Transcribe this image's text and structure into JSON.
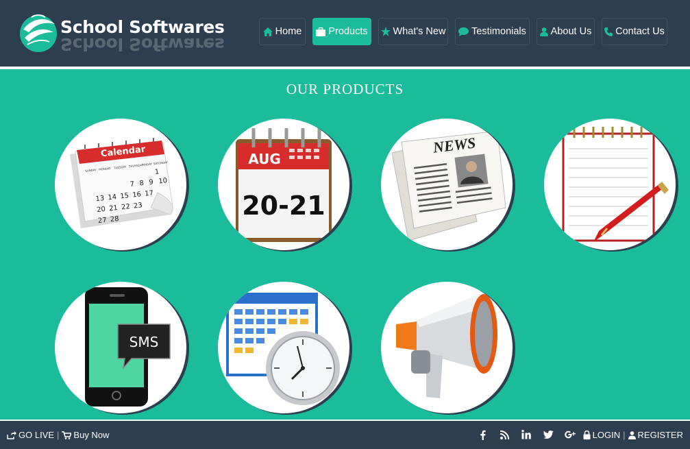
{
  "brand": {
    "title": "School Softwares"
  },
  "nav": {
    "items": [
      {
        "label": "Home",
        "icon": "home-icon"
      },
      {
        "label": "Products",
        "icon": "briefcase-icon",
        "active": true
      },
      {
        "label": "What's New",
        "icon": "star-icon"
      },
      {
        "label": "Testimonials",
        "icon": "comment-icon"
      },
      {
        "label": "About Us",
        "icon": "user-icon"
      },
      {
        "label": "Contact Us",
        "icon": "phone-icon"
      }
    ]
  },
  "main": {
    "section_title": "OUR PRODUCTS",
    "products": [
      {
        "icon": "calendar-icon",
        "image_text": [
          "Calendar",
          "SUNDAY",
          "MONDAY",
          "TUESDAY",
          "THURSDAY",
          "FRIDAY",
          "SATURDAY",
          "1",
          "7",
          "8",
          "9",
          "10",
          "13",
          "14",
          "15",
          "16",
          "17",
          "20",
          "21",
          "22",
          "23",
          "27",
          "28"
        ]
      },
      {
        "icon": "date-calendar-icon",
        "image_text": [
          "AUG",
          "20-21"
        ]
      },
      {
        "icon": "newspaper-icon",
        "image_text": [
          "NEWS"
        ]
      },
      {
        "icon": "notepad-pen-icon",
        "image_text": []
      },
      {
        "icon": "sms-phone-icon",
        "image_text": [
          "SMS"
        ]
      },
      {
        "icon": "schedule-clock-icon",
        "image_text": []
      },
      {
        "icon": "megaphone-icon",
        "image_text": []
      }
    ]
  },
  "footer": {
    "go_live": "GO LIVE",
    "separator": "|",
    "buy_now": "Buy Now",
    "social": [
      "facebook-icon",
      "rss-icon",
      "linkedin-icon",
      "twitter-icon",
      "google-plus-icon"
    ],
    "login": "LOGIN",
    "register": "REGISTER"
  },
  "colors": {
    "header": "#2c3e50",
    "accent": "#1bbc9b",
    "white": "#ffffff"
  }
}
